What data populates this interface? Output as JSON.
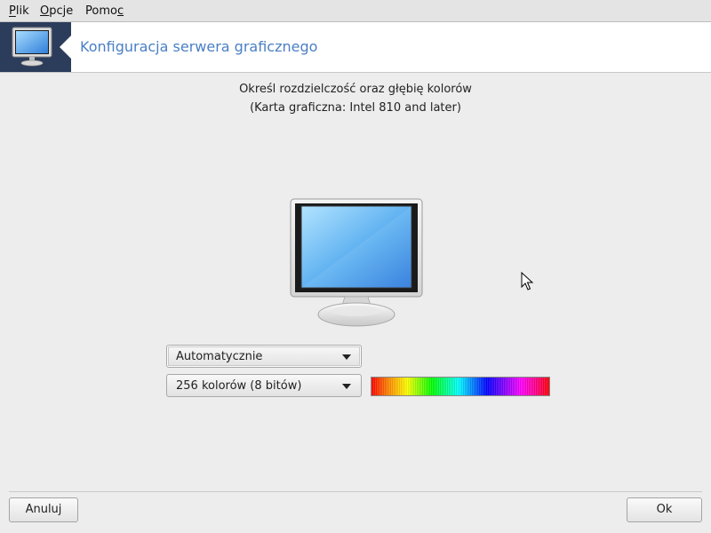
{
  "menubar": {
    "items": [
      {
        "label": "Plik",
        "mnemonic": "P"
      },
      {
        "label": "Opcje",
        "mnemonic": "O"
      },
      {
        "label": "Pomoc",
        "mnemonic": "c"
      }
    ]
  },
  "banner": {
    "title": "Konfiguracja serwera graficznego",
    "icon": "monitor-icon"
  },
  "main": {
    "instruction": "Określ rozdzielczość oraz głębię kolorów",
    "card_info": "(Karta graficzna: Intel 810 and later)",
    "resolution_select": {
      "value": "Automatycznie"
    },
    "depth_select": {
      "value": "256 kolorów (8 bitów)"
    }
  },
  "buttons": {
    "cancel": "Anuluj",
    "ok": "Ok"
  },
  "colors": {
    "title_blue": "#4a7fc4",
    "banner_dark": "#2c3c5b",
    "background": "#ededed"
  }
}
